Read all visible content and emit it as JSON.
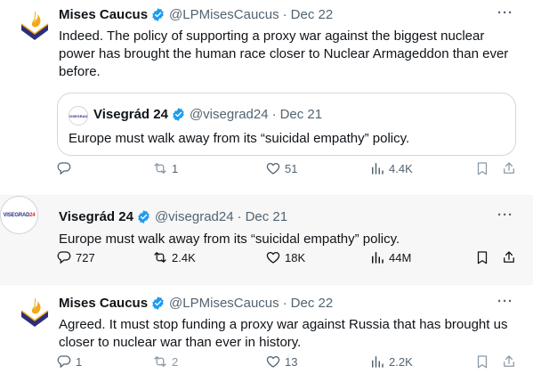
{
  "colors": {
    "text_primary": "#0f1419",
    "text_secondary": "#536471",
    "verified_blue": "#1d9bf0",
    "focused_bg": "#f7f7f7",
    "border": "#cfd9de"
  },
  "tweets": [
    {
      "name": "Mises Caucus",
      "handle": "@LPMisesCaucus",
      "separator": "·",
      "date": "Dec 22",
      "text": "Indeed. The policy of supporting a proxy war against the biggest nuclear power has brought the human race closer to Nuclear Armageddon than ever before.",
      "more": "···",
      "quote": {
        "name": "Visegrád 24",
        "handle": "@visegrad24",
        "separator": "·",
        "date": "Dec 21",
        "text": "Europe must walk away from its “suicidal empathy” policy."
      },
      "replies": "",
      "retweets": "1",
      "likes": "51",
      "views": "4.4K"
    },
    {
      "name": "Visegrád 24",
      "handle": "@visegrad24",
      "separator": "·",
      "date": "Dec 21",
      "text": "Europe must walk away from its “suicidal empathy” policy.",
      "more": "···",
      "avatar_text_a": "VISEGRAD",
      "avatar_text_b": "24",
      "replies": "727",
      "retweets": "2.4K",
      "likes": "18K",
      "views": "44M"
    },
    {
      "name": "Mises Caucus",
      "handle": "@LPMisesCaucus",
      "separator": "·",
      "date": "Dec 22",
      "text": "Agreed. It must stop funding a proxy war against Russia that has brought us closer to nuclear war than ever in history.",
      "more": "···",
      "replies": "1",
      "retweets": "2",
      "likes": "13",
      "views": "2.2K"
    }
  ],
  "icons": {
    "reply": "reply-icon",
    "retweet": "retweet-icon",
    "like": "heart-icon",
    "views": "views-icon",
    "bookmark": "bookmark-icon",
    "share": "share-icon",
    "verified": "verified-badge-icon"
  }
}
